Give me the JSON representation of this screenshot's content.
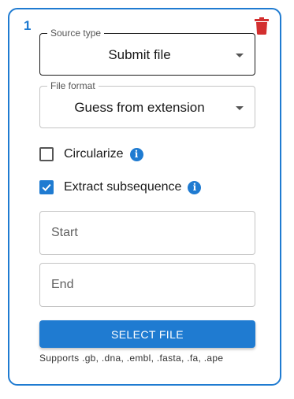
{
  "card": {
    "number": "1",
    "accent_color": "#1f7bd1",
    "delete_icon": "trash-icon",
    "delete_color": "#d32f2f"
  },
  "source_type": {
    "label": "Source type",
    "value": "Submit file"
  },
  "file_format": {
    "label": "File format",
    "value": "Guess from extension"
  },
  "options": {
    "circularize": {
      "label": "Circularize",
      "checked": false,
      "info_icon": "info-icon"
    },
    "extract_subsequence": {
      "label": "Extract subsequence",
      "checked": true,
      "info_icon": "info-icon"
    }
  },
  "subsequence": {
    "start_placeholder": "Start",
    "start_value": "",
    "end_placeholder": "End",
    "end_value": ""
  },
  "actions": {
    "select_file_label": "SELECT FILE",
    "supported_formats": "Supports .gb, .dna, .embl, .fasta, .fa, .ape"
  }
}
